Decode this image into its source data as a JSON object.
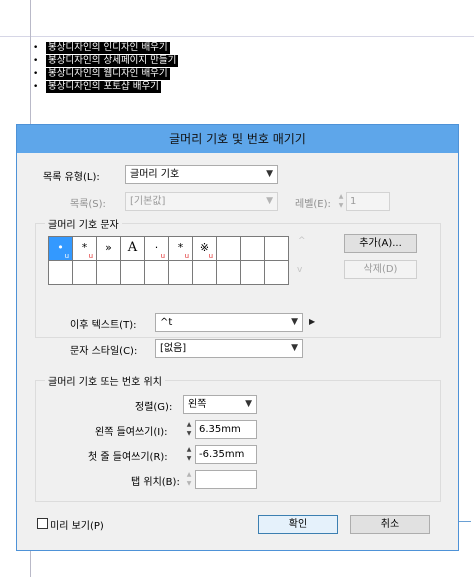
{
  "document": {
    "bullet": "•",
    "lines": [
      "봉상디자인의 인디자인 배우기",
      "봉상디자인의 상세페이지 만들기",
      "봉상디자인의 웹디자인 배우기",
      "봉상디자인의 포토샵 배우기"
    ]
  },
  "dialog": {
    "title": "글머리 기호 및 번호 매기기",
    "list_type_label": "목록 유형(L):",
    "list_type_value": "글머리 기호",
    "list_label": "목록(S):",
    "list_value": "[기본값]",
    "level_label": "레벨(E):",
    "level_value": "1",
    "bullet_chars_group": "글머리 기호 문자",
    "bullet_chars": [
      "•",
      "*",
      "»",
      "A",
      "·",
      "*",
      "※",
      "",
      "",
      ""
    ],
    "add_button": "추가(A)...",
    "delete_button": "삭제(D)",
    "text_after_label": "이후 텍스트(T):",
    "text_after_value": "^t",
    "char_style_label": "문자 스타일(C):",
    "char_style_value": "[없음]",
    "position_group": "글머리 기호 또는 번호 위치",
    "alignment_label": "정렬(G):",
    "alignment_value": "왼쪽",
    "left_indent_label": "왼쪽 들여쓰기(I):",
    "left_indent_value": "6.35mm",
    "first_line_indent_label": "첫 줄 들여쓰기(R):",
    "first_line_indent_value": "-6.35mm",
    "tab_position_label": "탭 위치(B):",
    "tab_position_value": "",
    "preview_label": "미리 보기(P)",
    "ok_button": "확인",
    "cancel_button": "취소"
  },
  "icons": {
    "dropdown": "chevron-down",
    "spinner": "up-down-arrows",
    "flyout": "right-triangle"
  },
  "colors": {
    "titlebar": "#5ea6ea",
    "dialog_border": "#4e92d7",
    "selection": "#3399ff",
    "bullet_marker": "#e03030"
  }
}
